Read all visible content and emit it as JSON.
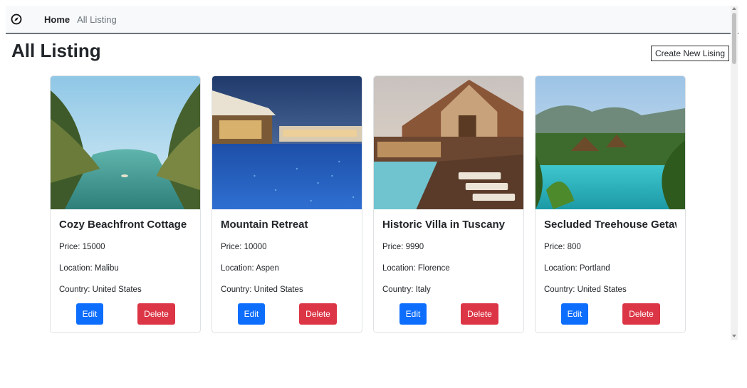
{
  "nav": {
    "home": "Home",
    "all_listing": "All Listing",
    "brand_icon": "compass-icon"
  },
  "page": {
    "title": "All Listing",
    "create_button": "Create New Lising"
  },
  "colors": {
    "primary": "#0d6efd",
    "danger": "#dc3545",
    "navbar_bg": "#f8f9fa"
  },
  "listings": [
    {
      "title": "Cozy Beachfront Cottage",
      "price": "Price: 15000",
      "location": "Location: Malibu",
      "country": "Country: United States",
      "edit": "Edit",
      "delete": "Delete"
    },
    {
      "title": "Mountain Retreat",
      "price": "Price: 10000",
      "location": "Location: Aspen",
      "country": "Country: United States",
      "edit": "Edit",
      "delete": "Delete"
    },
    {
      "title": "Historic Villa in Tuscany",
      "price": "Price: 9990",
      "location": "Location: Florence",
      "country": "Country: Italy",
      "edit": "Edit",
      "delete": "Delete"
    },
    {
      "title": "Secluded Treehouse Getawa",
      "price": "Price: 800",
      "location": "Location: Portland",
      "country": "Country: United States",
      "edit": "Edit",
      "delete": "Delete"
    }
  ]
}
